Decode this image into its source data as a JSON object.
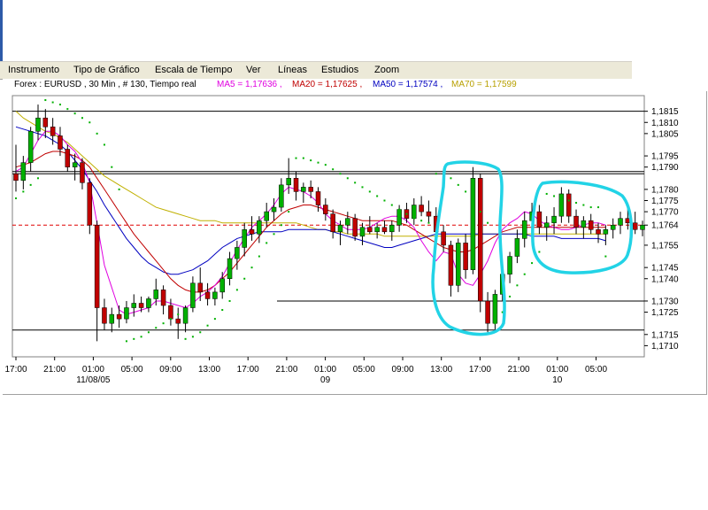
{
  "menu": {
    "items": [
      {
        "label": "Instrumento"
      },
      {
        "label": "Tipo de Gráfico"
      },
      {
        "label": "Escala de Tiempo"
      },
      {
        "label": "Ver"
      },
      {
        "label": "Líneas"
      },
      {
        "label": "Estudios"
      },
      {
        "label": "Zoom"
      }
    ]
  },
  "infobar": {
    "symbol": "Forex : EURUSD , 30 Min , # 130, Tiempo real",
    "ma5": "MA5 = 1,17636 ,",
    "ma20": "MA20 = 1,17625 ,",
    "ma50": "MA50 = 1,17574 ,",
    "ma70": "MA70 = 1,17599"
  },
  "colors": {
    "ma5": "#e000e0",
    "ma20": "#c00000",
    "ma50": "#0000c0",
    "ma70": "#c0b000",
    "candle_up": "#00b000",
    "candle_down": "#c00000",
    "sar": "#00b000",
    "annotation": "#22d3e6",
    "current_price": "#e00000"
  },
  "chart_data": {
    "type": "candlestick",
    "title": "Forex : EURUSD , 30 Min , # 130, Tiempo real",
    "xlabel": "",
    "ylabel": "",
    "ylim": [
      1.1705,
      1.1822
    ],
    "y_ticks": [
      "1,1815",
      "1,1810",
      "1,1805",
      "1,1795",
      "1,1790",
      "1,1780",
      "1,1775",
      "1,1770",
      "1,1764",
      "1,1755",
      "1,1745",
      "1,1740",
      "1,1730",
      "1,1725",
      "1,1715",
      "1,1710"
    ],
    "x_ticks": [
      "17:00",
      "21:00",
      "01:00",
      "05:00",
      "09:00",
      "13:00",
      "17:00",
      "21:00",
      "01:00",
      "05:00",
      "09:00",
      "13:00",
      "17:00",
      "21:00",
      "01:00",
      "05:00"
    ],
    "date_labels": [
      "11/08/05",
      "09",
      "10"
    ],
    "current_price": 1.1764,
    "horizontal_levels": [
      1.1815,
      1.1788,
      1.1787,
      1.1717
    ],
    "partial_level": 1.173,
    "candles": [
      [
        1.1787,
        1.18,
        1.1779,
        1.1784
      ],
      [
        1.1784,
        1.1795,
        1.178,
        1.1792
      ],
      [
        1.1792,
        1.1808,
        1.1788,
        1.1806
      ],
      [
        1.1806,
        1.1818,
        1.1802,
        1.1812
      ],
      [
        1.1812,
        1.1816,
        1.1803,
        1.1808
      ],
      [
        1.1808,
        1.1812,
        1.18,
        1.1804
      ],
      [
        1.1804,
        1.1808,
        1.1795,
        1.1798
      ],
      [
        1.1798,
        1.18,
        1.1788,
        1.179
      ],
      [
        1.179,
        1.1796,
        1.1784,
        1.1792
      ],
      [
        1.1792,
        1.1794,
        1.178,
        1.1783
      ],
      [
        1.1783,
        1.1785,
        1.176,
        1.1764
      ],
      [
        1.1764,
        1.1766,
        1.1712,
        1.1727
      ],
      [
        1.1727,
        1.1731,
        1.1717,
        1.172
      ],
      [
        1.172,
        1.1727,
        1.1716,
        1.1724
      ],
      [
        1.1724,
        1.1728,
        1.1718,
        1.1722
      ],
      [
        1.1722,
        1.173,
        1.172,
        1.1727
      ],
      [
        1.1727,
        1.1733,
        1.1723,
        1.1729
      ],
      [
        1.1729,
        1.1732,
        1.1725,
        1.1727
      ],
      [
        1.1727,
        1.1732,
        1.1725,
        1.1731
      ],
      [
        1.1731,
        1.174,
        1.1728,
        1.1735
      ],
      [
        1.1735,
        1.1737,
        1.1724,
        1.1728
      ],
      [
        1.1728,
        1.1731,
        1.1719,
        1.1722
      ],
      [
        1.1722,
        1.1727,
        1.1713,
        1.172
      ],
      [
        1.172,
        1.1728,
        1.1716,
        1.1727
      ],
      [
        1.1727,
        1.1741,
        1.1725,
        1.1738
      ],
      [
        1.1738,
        1.1745,
        1.173,
        1.1734
      ],
      [
        1.1734,
        1.1738,
        1.1728,
        1.1731
      ],
      [
        1.1731,
        1.1736,
        1.1728,
        1.1734
      ],
      [
        1.1734,
        1.1743,
        1.1731,
        1.174
      ],
      [
        1.174,
        1.1752,
        1.1737,
        1.1749
      ],
      [
        1.1749,
        1.1757,
        1.1744,
        1.1754
      ],
      [
        1.1754,
        1.1765,
        1.175,
        1.1762
      ],
      [
        1.1762,
        1.1768,
        1.1757,
        1.176
      ],
      [
        1.176,
        1.1768,
        1.1756,
        1.1766
      ],
      [
        1.1766,
        1.1774,
        1.1763,
        1.177
      ],
      [
        1.177,
        1.1776,
        1.1766,
        1.1772
      ],
      [
        1.1772,
        1.1785,
        1.177,
        1.1782
      ],
      [
        1.1782,
        1.1794,
        1.1778,
        1.1785
      ],
      [
        1.1785,
        1.1788,
        1.1775,
        1.1779
      ],
      [
        1.1779,
        1.1783,
        1.1774,
        1.1781
      ],
      [
        1.1781,
        1.1784,
        1.1776,
        1.1779
      ],
      [
        1.1779,
        1.1781,
        1.177,
        1.1773
      ],
      [
        1.1773,
        1.1776,
        1.1766,
        1.1769
      ],
      [
        1.1769,
        1.1771,
        1.1758,
        1.1761
      ],
      [
        1.1761,
        1.1766,
        1.1755,
        1.1764
      ],
      [
        1.1764,
        1.177,
        1.176,
        1.1767
      ],
      [
        1.1767,
        1.1769,
        1.1757,
        1.1759
      ],
      [
        1.1759,
        1.1765,
        1.1755,
        1.1763
      ],
      [
        1.1763,
        1.1768,
        1.176,
        1.1761
      ],
      [
        1.1761,
        1.1765,
        1.1758,
        1.1763
      ],
      [
        1.1763,
        1.1766,
        1.176,
        1.1761
      ],
      [
        1.1761,
        1.1766,
        1.1757,
        1.1764
      ],
      [
        1.1764,
        1.1773,
        1.1761,
        1.1771
      ],
      [
        1.1771,
        1.1774,
        1.1765,
        1.1767
      ],
      [
        1.1767,
        1.1776,
        1.1764,
        1.1773
      ],
      [
        1.1773,
        1.1777,
        1.1768,
        1.177
      ],
      [
        1.177,
        1.1775,
        1.1765,
        1.1768
      ],
      [
        1.1768,
        1.1772,
        1.1758,
        1.1761
      ],
      [
        1.1761,
        1.1764,
        1.1752,
        1.1755
      ],
      [
        1.1755,
        1.1757,
        1.1732,
        1.1737
      ],
      [
        1.1737,
        1.1758,
        1.1734,
        1.1756
      ],
      [
        1.1756,
        1.176,
        1.174,
        1.1744
      ],
      [
        1.1744,
        1.179,
        1.1742,
        1.1785
      ],
      [
        1.1785,
        1.1787,
        1.1725,
        1.173
      ],
      [
        1.173,
        1.1734,
        1.1716,
        1.172
      ],
      [
        1.172,
        1.1735,
        1.1717,
        1.1733
      ],
      [
        1.1733,
        1.1745,
        1.173,
        1.1742
      ],
      [
        1.1742,
        1.1752,
        1.1738,
        1.175
      ],
      [
        1.175,
        1.1762,
        1.1747,
        1.1758
      ],
      [
        1.1758,
        1.177,
        1.1754,
        1.1766
      ],
      [
        1.1766,
        1.1774,
        1.176,
        1.177
      ],
      [
        1.177,
        1.1773,
        1.176,
        1.1763
      ],
      [
        1.1763,
        1.1768,
        1.1757,
        1.1765
      ],
      [
        1.1765,
        1.1772,
        1.176,
        1.1768
      ],
      [
        1.1768,
        1.1781,
        1.1765,
        1.1778
      ],
      [
        1.1778,
        1.178,
        1.1765,
        1.1768
      ],
      [
        1.1768,
        1.1771,
        1.176,
        1.1763
      ],
      [
        1.1763,
        1.1768,
        1.1758,
        1.1766
      ],
      [
        1.1766,
        1.1769,
        1.176,
        1.1762
      ],
      [
        1.1762,
        1.1765,
        1.1756,
        1.176
      ],
      [
        1.176,
        1.1764,
        1.1755,
        1.1762
      ],
      [
        1.1762,
        1.1767,
        1.1758,
        1.1764
      ],
      [
        1.1764,
        1.177,
        1.176,
        1.1767
      ],
      [
        1.1767,
        1.1773,
        1.1762,
        1.1765
      ],
      [
        1.1765,
        1.177,
        1.176,
        1.1762
      ],
      [
        1.1762,
        1.1766,
        1.1759,
        1.1764
      ]
    ],
    "ma5": [
      1.1788,
      1.179,
      1.1796,
      1.1802,
      1.1806,
      1.1806,
      1.1804,
      1.18,
      1.1797,
      1.1792,
      1.1783,
      1.1765,
      1.1746,
      1.1736,
      1.1726,
      1.1724,
      1.1725,
      1.1726,
      1.1727,
      1.173,
      1.173,
      1.1729,
      1.1728,
      1.1727,
      1.1729,
      1.1732,
      1.1734,
      1.1737,
      1.1741,
      1.1747,
      1.1753,
      1.1758,
      1.1763,
      1.1766,
      1.1769,
      1.1773,
      1.1778,
      1.1781,
      1.178,
      1.1779,
      1.1777,
      1.1774,
      1.1769,
      1.1766,
      1.1764,
      1.1762,
      1.1762,
      1.1762,
      1.1763,
      1.1765,
      1.1767,
      1.1768,
      1.1768,
      1.1766,
      1.1763,
      1.1757,
      1.1752,
      1.1748,
      1.1752,
      1.1751,
      1.1742,
      1.1738,
      1.1737,
      1.1742,
      1.1748,
      1.1756,
      1.1762,
      1.1765,
      1.1767,
      1.177,
      1.1769,
      1.1766,
      1.1764,
      1.1763,
      1.1762,
      1.1762,
      1.1763,
      1.1764,
      1.1765,
      1.1765,
      1.1764
    ],
    "ma20": [
      1.179,
      1.1791,
      1.1792,
      1.1794,
      1.1796,
      1.1797,
      1.1797,
      1.1796,
      1.1795,
      1.1793,
      1.179,
      1.1785,
      1.178,
      1.1775,
      1.177,
      1.1765,
      1.176,
      1.1756,
      1.1752,
      1.1748,
      1.1744,
      1.174,
      1.1737,
      1.1735,
      1.1734,
      1.1734,
      1.1735,
      1.1737,
      1.174,
      1.1743,
      1.1747,
      1.1751,
      1.1755,
      1.1759,
      1.1763,
      1.1766,
      1.1769,
      1.1771,
      1.1772,
      1.1773,
      1.1773,
      1.1772,
      1.1771,
      1.177,
      1.1769,
      1.1768,
      1.1767,
      1.1766,
      1.1766,
      1.1766,
      1.1766,
      1.1766,
      1.1765,
      1.1764,
      1.1762,
      1.176,
      1.1758,
      1.1756,
      1.1754,
      1.1753,
      1.1752,
      1.1752,
      1.1753,
      1.1755,
      1.1757,
      1.1759,
      1.1761,
      1.1762,
      1.1763,
      1.1763,
      1.1763,
      1.1763,
      1.1763,
      1.1763,
      1.1763,
      1.1763,
      1.1763,
      1.1763,
      1.1763,
      1.1763,
      1.1763
    ],
    "ma50": [
      1.1808,
      1.1807,
      1.1806,
      1.1805,
      1.1804,
      1.1802,
      1.18,
      1.1797,
      1.1793,
      1.1789,
      1.1784,
      1.1779,
      1.1773,
      1.1768,
      1.1763,
      1.1758,
      1.1754,
      1.175,
      1.1747,
      1.1745,
      1.1743,
      1.1742,
      1.1742,
      1.1743,
      1.1744,
      1.1746,
      1.1748,
      1.1751,
      1.1754,
      1.1756,
      1.1758,
      1.1759,
      1.176,
      1.1761,
      1.1761,
      1.1761,
      1.1761,
      1.1762,
      1.1762,
      1.1762,
      1.1762,
      1.1762,
      1.1762,
      1.1761,
      1.176,
      1.1759,
      1.1758,
      1.1757,
      1.1756,
      1.1755,
      1.1754,
      1.1754,
      1.1755,
      1.1756,
      1.1757,
      1.1758,
      1.1759,
      1.176,
      1.176,
      1.176,
      1.176,
      1.176,
      1.176,
      1.176,
      1.176,
      1.176,
      1.176,
      1.176,
      1.176,
      1.176,
      1.1759,
      1.1759,
      1.1759,
      1.1759,
      1.1758,
      1.1758,
      1.1758,
      1.1758,
      1.1758,
      1.1758,
      1.1757
    ],
    "ma70": [
      1.1815,
      1.1812,
      1.181,
      1.1808,
      1.1806,
      1.1805,
      1.1803,
      1.1801,
      1.1798,
      1.1795,
      1.1792,
      1.1789,
      1.1786,
      1.1784,
      1.1782,
      1.178,
      1.1778,
      1.1776,
      1.1774,
      1.1772,
      1.1771,
      1.177,
      1.1769,
      1.1768,
      1.1767,
      1.1766,
      1.1766,
      1.1766,
      1.1765,
      1.1765,
      1.1765,
      1.1765,
      1.1765,
      1.1765,
      1.1765,
      1.1765,
      1.1765,
      1.1765,
      1.1765,
      1.1764,
      1.1763,
      1.1762,
      1.1762,
      1.1761,
      1.1761,
      1.176,
      1.176,
      1.176,
      1.176,
      1.176,
      1.1759,
      1.1759,
      1.1759,
      1.1759,
      1.1759,
      1.1759,
      1.1759,
      1.1759,
      1.1759,
      1.1759,
      1.1759,
      1.1759,
      1.1759,
      1.176,
      1.176,
      1.176,
      1.176,
      1.176,
      1.176,
      1.176,
      1.176,
      1.176,
      1.176,
      1.176,
      1.176,
      1.176,
      1.176,
      1.176,
      1.176,
      1.176,
      1.176
    ],
    "sar": [
      1.1776,
      1.1779,
      1.1782,
      1.1785,
      1.182,
      1.1819,
      1.1818,
      1.1816,
      1.1814,
      1.1812,
      1.181,
      1.1805,
      1.18,
      1.179,
      1.178,
      1.1712,
      1.1713,
      1.1714,
      1.1716,
      1.1718,
      1.172,
      1.1722,
      1.1724,
      1.1713,
      1.1714,
      1.1716,
      1.1719,
      1.1722,
      1.1726,
      1.173,
      1.1735,
      1.174,
      1.1745,
      1.175,
      1.1756,
      1.176,
      1.1764,
      1.177,
      1.1794,
      1.1794,
      1.1793,
      1.1792,
      1.1791,
      1.1789,
      1.1787,
      1.1785,
      1.1783,
      1.1781,
      1.1779,
      1.1777,
      1.1775,
      1.1773,
      1.1771,
      1.1769,
      1.1767,
      1.1766,
      1.1765,
      1.1787,
      1.1786,
      1.1785,
      1.1782,
      1.1779,
      1.1775,
      1.177,
      1.1765,
      1.172,
      1.1725,
      1.1732,
      1.1737,
      1.1742,
      1.1747,
      1.1752,
      1.1778,
      1.1777,
      1.1776,
      1.1775,
      1.1774,
      1.1773,
      1.1772,
      1.1772,
      1.175
    ]
  }
}
